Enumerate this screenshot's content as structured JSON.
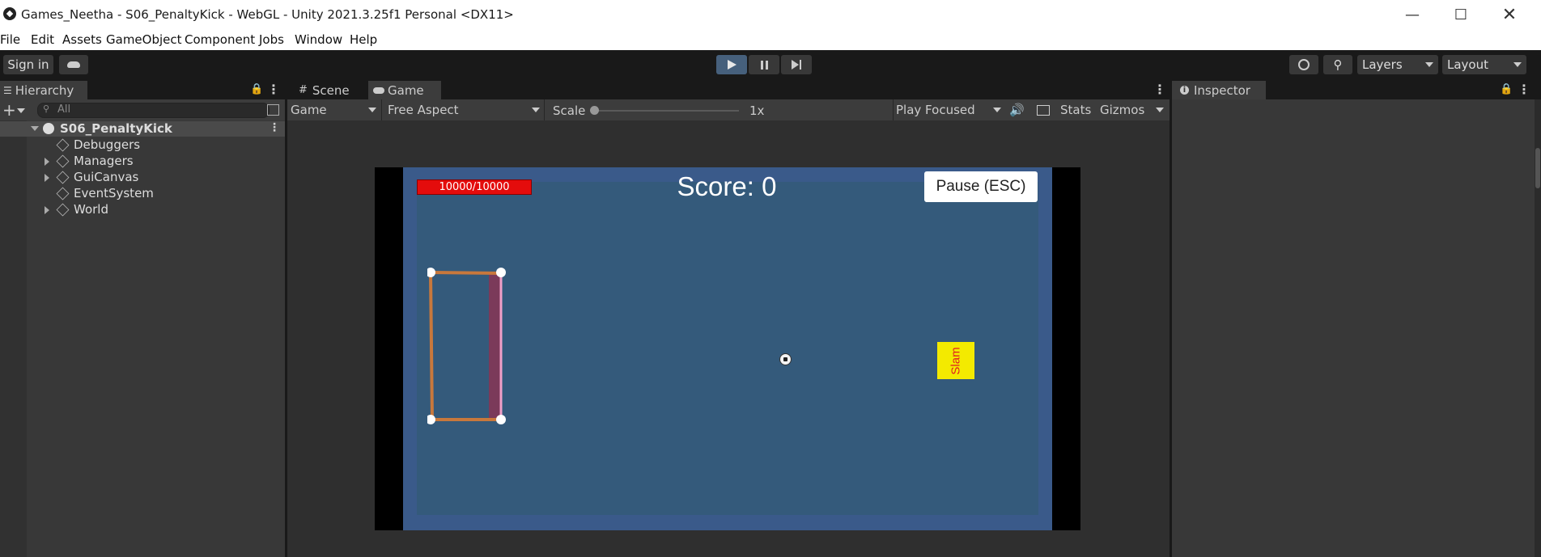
{
  "window": {
    "title": "Games_Neetha - S06_PenaltyKick - WebGL - Unity 2021.3.25f1 Personal <DX11>"
  },
  "menu": [
    "File",
    "Edit",
    "Assets",
    "GameObject",
    "Component",
    "Jobs",
    "Window",
    "Help"
  ],
  "toolbar": {
    "sign_in": "Sign in",
    "layers": "Layers",
    "layout": "Layout"
  },
  "hierarchy": {
    "tab": "Hierarchy",
    "search_placeholder": "All",
    "scene": "S06_PenaltyKick",
    "items": [
      "Debuggers",
      "Managers",
      "GuiCanvas",
      "EventSystem",
      "World"
    ]
  },
  "center": {
    "tabs": [
      "Scene",
      "Game"
    ],
    "display_dropdown": "Game",
    "aspect_dropdown": "Free Aspect",
    "scale_label": "Scale",
    "scale_value": "1x",
    "play_mode": "Play Focused",
    "stats": "Stats",
    "gizmos": "Gizmos"
  },
  "game": {
    "health": "10000/10000",
    "score": "Score: 0",
    "pause": "Pause (ESC)",
    "slam": "Slam"
  },
  "inspector": {
    "tab": "Inspector"
  },
  "colors": {
    "game_bg": "#34587a",
    "play_active": "#46607c",
    "goal": "#c8783c",
    "health": "#e02020",
    "slam_bg": "#f3ea00"
  }
}
